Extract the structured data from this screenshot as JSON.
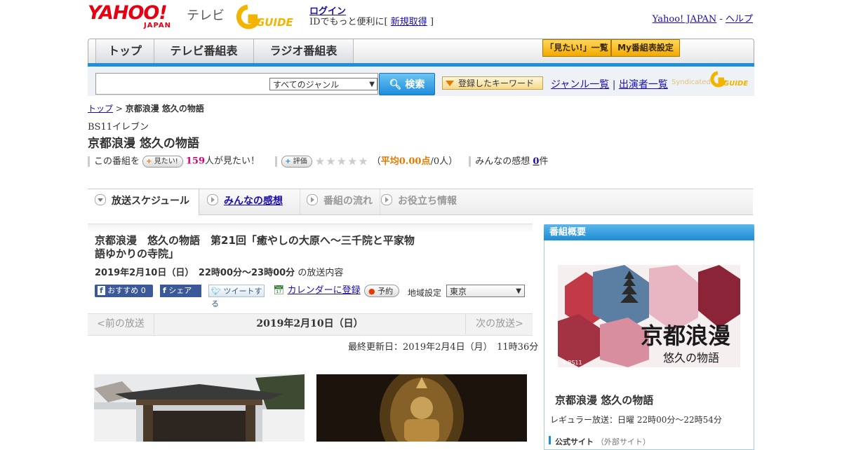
{
  "header": {
    "yahoo_logo": "YAHOO!",
    "yahoo_sub": "JAPAN",
    "tv_label": "テレビ",
    "gguide_logo": "GUIDE",
    "login_link": "ログイン",
    "login_sub_prefix": "IDでもっと便利に[",
    "signup_link": "新規取得",
    "login_sub_suffix": "]",
    "yahoo_japan_link": "Yahoo! JAPAN",
    "separator": "-",
    "help_link": "ヘルプ"
  },
  "nav": {
    "tabs": [
      "トップ",
      "テレビ番組表",
      "ラジオ番組表"
    ],
    "mitai_list": "「見たい!」一覧",
    "my_schedule": "My番組表設定"
  },
  "search": {
    "input_value": "",
    "genre_value": "すべてのジャンル",
    "search_button": "検索",
    "keyword_button": "登録したキーワード",
    "genre_list": "ジャンル一覧",
    "divider": "|",
    "cast_list": "出演者一覧",
    "syndicated": "Syndicated"
  },
  "breadcrumb": {
    "top": "トップ",
    "sep": ">",
    "current": "京都浪漫 悠久の物語"
  },
  "program": {
    "channel": "BS11イレブン",
    "title": "京都浪漫 悠久の物語",
    "stats_prefix": "この番組を",
    "mitai_pill": "見たい!",
    "mitai_count": "159",
    "mitai_suffix": "人が見たい！",
    "rate_pill": "評価",
    "avg_open": "（",
    "avg_label": "平均0.00点",
    "avg_people": "/0人）",
    "impressions_prefix": "みんなの感想",
    "impressions_count": "0",
    "impressions_suffix": "件"
  },
  "tabs": [
    "放送スケジュール",
    "みんなの感想",
    "番組の流れ",
    "お役立ち情報"
  ],
  "broadcast": {
    "title": "京都浪漫　悠久の物語　第21回「癒やしの大原へ～三千院と平家物語ゆかりの寺院」",
    "datetime": "2019年2月10日（日）　22時00分～23時00分",
    "datetime_suffix": "の放送内容",
    "fb_recommend": "おすすめ",
    "fb_count": "0",
    "fb_share": "シェア",
    "tweet": "ツイートする",
    "calendar": "カレンダーに登録",
    "reserve": "予約",
    "region_label": "地域設定",
    "region_value": "東京",
    "prev": "<前の放送",
    "current_date": "2019年2月10日（日）",
    "next": "次の放送>",
    "updated": "最終更新日：2019年2月4日（月）　11時36分"
  },
  "sidebar": {
    "header": "番組概要",
    "image_credit": "©BS11",
    "image_title": "京都浪漫",
    "image_subtitle": "悠久の物語",
    "title": "京都浪漫 悠久の物語",
    "regular": "レギュラー放送：日曜 22時00分～22時54分",
    "official": "公式サイト",
    "official_note": "（外部サイト）"
  },
  "colors": {
    "brand_red": "#e60012",
    "accent_blue": "#1f8bd3",
    "link": "#1a0dab",
    "pink_count": "#d6006f",
    "avg_orange": "#e47a00"
  }
}
